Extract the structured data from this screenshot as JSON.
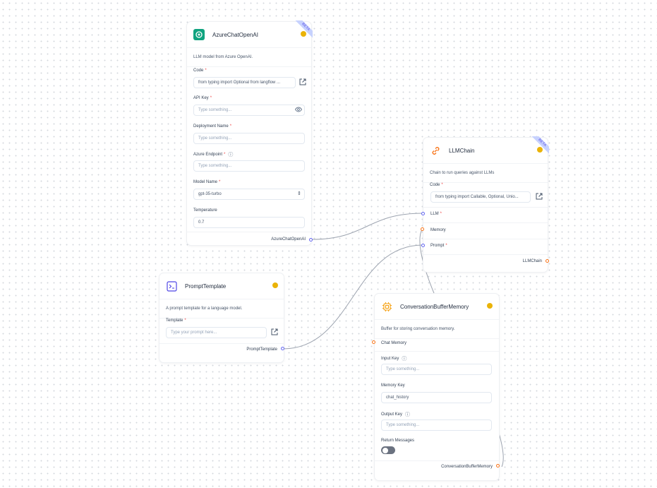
{
  "colors": {
    "accent": "#6366f1",
    "output_handle": "#f97316",
    "status": "#eab308",
    "edge": "#9ca3af",
    "beta_badge_bg": "#c7d2fe",
    "beta_badge_text": "#4f46e5"
  },
  "nodes": {
    "azure": {
      "title": "AzureChatOpenAI",
      "icon": "openai-icon",
      "badge": "BETA",
      "description": "LLM model from Azure OpenAI.",
      "fields": {
        "code": {
          "label": "Code",
          "value": "from typing import Optional from langflow ..."
        },
        "api_key": {
          "label": "API Key",
          "placeholder": "Type something..."
        },
        "deployment_name": {
          "label": "Deployment Name",
          "placeholder": "Type something..."
        },
        "azure_endpoint": {
          "label": "Azure Endpoint",
          "placeholder": "Type something..."
        },
        "model_name": {
          "label": "Model Name",
          "value": "gpt-35-turbo"
        },
        "temperature": {
          "label": "Temperature",
          "value": "0.7"
        }
      },
      "output": "AzureChatOpenAI"
    },
    "llmchain": {
      "title": "LLMChain",
      "icon": "link-icon",
      "badge": "BETA",
      "description": "Chain to run queries against LLMs",
      "fields": {
        "code": {
          "label": "Code",
          "value": "from typing import Callable, Optional, Unio..."
        }
      },
      "inputs": {
        "llm": "LLM",
        "memory": "Memory",
        "prompt": "Prompt"
      },
      "output": "LLMChain"
    },
    "prompt": {
      "title": "PromptTemplate",
      "icon": "terminal-icon",
      "description": "A prompt template for a language model.",
      "fields": {
        "template": {
          "label": "Template",
          "placeholder": "Type your prompt here..."
        }
      },
      "output": "PromptTemplate"
    },
    "memory": {
      "title": "ConversationBufferMemory",
      "icon": "cpu-icon",
      "description": "Buffer for storing conversation memory.",
      "inputs": {
        "chat_memory": "Chat Memory"
      },
      "fields": {
        "input_key": {
          "label": "Input Key",
          "placeholder": "Type something..."
        },
        "memory_key": {
          "label": "Memory Key",
          "value": "chat_history"
        },
        "output_key": {
          "label": "Output Key",
          "placeholder": "Type something..."
        },
        "return_messages": {
          "label": "Return Messages",
          "value": "off"
        }
      },
      "output": "ConversationBufferMemory"
    }
  }
}
